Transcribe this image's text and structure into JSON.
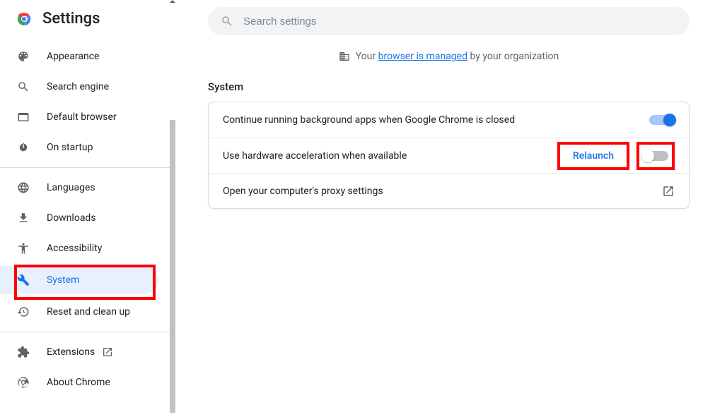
{
  "app_title": "Settings",
  "search": {
    "placeholder": "Search settings"
  },
  "managed": {
    "prefix": "Your ",
    "link": "browser is managed",
    "suffix": " by your organization"
  },
  "sidebar": {
    "items": [
      {
        "label": "Appearance"
      },
      {
        "label": "Search engine"
      },
      {
        "label": "Default browser"
      },
      {
        "label": "On startup"
      },
      {
        "label": "Languages"
      },
      {
        "label": "Downloads"
      },
      {
        "label": "Accessibility"
      },
      {
        "label": "System"
      },
      {
        "label": "Reset and clean up"
      },
      {
        "label": "Extensions"
      },
      {
        "label": "About Chrome"
      }
    ]
  },
  "section": {
    "title": "System"
  },
  "rows": {
    "r0": {
      "label": "Continue running background apps when Google Chrome is closed"
    },
    "r1": {
      "label": "Use hardware acceleration when available",
      "action": "Relaunch"
    },
    "r2": {
      "label": "Open your computer's proxy settings"
    }
  },
  "colors": {
    "accent": "#1a73e8",
    "highlight": "#ff0000"
  }
}
